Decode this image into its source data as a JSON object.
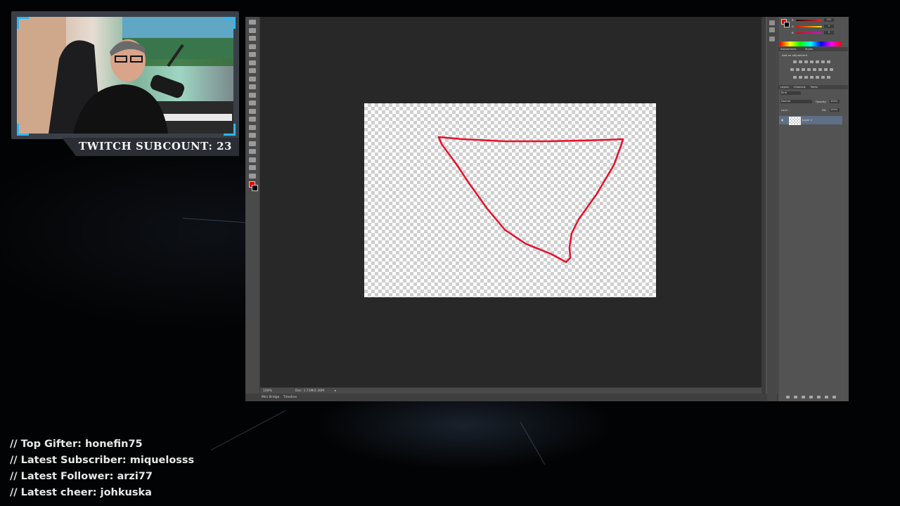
{
  "overlay": {
    "subcount": "TWITCH SUBCOUNT: 23",
    "stream_info": [
      "// Top Gifter: honefin75",
      "// Latest Subscriber: miquelosss",
      "// Latest Follower: arzi77",
      "// Latest cheer: johkuska"
    ],
    "accent_color": "#2fb7f2"
  },
  "photoshop": {
    "foreground_color": "#e00000",
    "background_color": "#000000",
    "status": {
      "zoom": "100%",
      "doc": "Doc: 1.73M/2.30M"
    },
    "bottom_tabs": [
      "Mini Bridge",
      "Timeline"
    ],
    "color_panel": {
      "r": "231",
      "g": "0",
      "b": "0"
    },
    "adjustments": {
      "tabs": [
        "Adjustments",
        "Styles"
      ],
      "heading": "Add an adjustment"
    },
    "layers": {
      "tabs": [
        "Layers",
        "Channels",
        "Paths"
      ],
      "kind": "Kind",
      "blend_mode": "Normal",
      "opacity_label": "Opacity:",
      "opacity_value": "100%",
      "lock_label": "Lock:",
      "fill_label": "Fill:",
      "fill_value": "100%",
      "layer_name": "Layer 1"
    },
    "stroke_color": "#e8102a",
    "canvas_icons": [
      "move-icon",
      "marquee-icon",
      "lasso-icon",
      "quick-select-icon",
      "crop-icon",
      "eyedropper-icon",
      "healing-icon",
      "brush-icon",
      "stamp-icon",
      "history-brush-icon",
      "eraser-icon",
      "gradient-icon",
      "blur-icon",
      "dodge-icon",
      "pen-icon",
      "type-icon",
      "path-select-icon",
      "shape-icon",
      "hand-icon",
      "zoom-icon"
    ]
  }
}
